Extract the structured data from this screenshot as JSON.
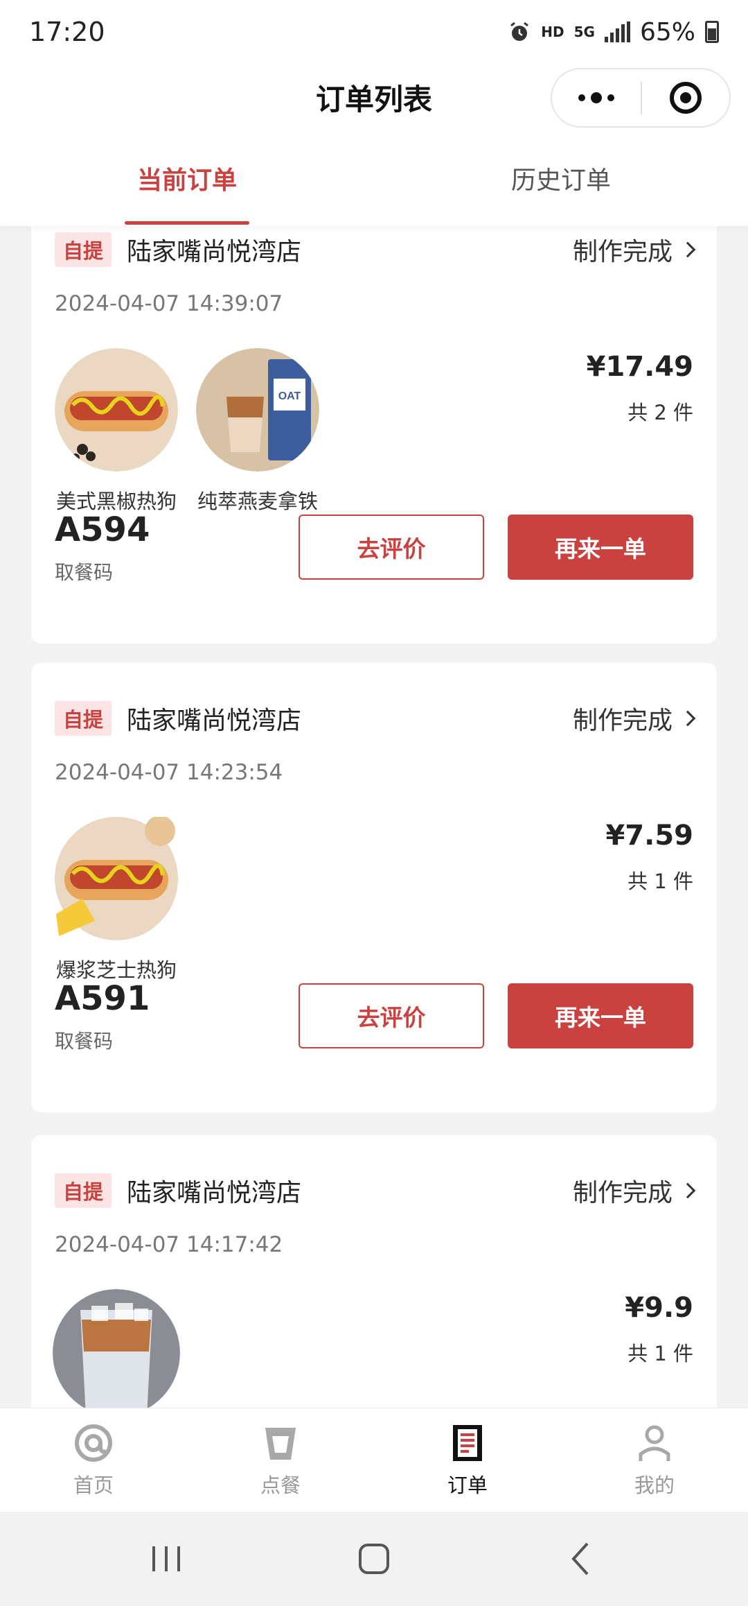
{
  "status_bar": {
    "time": "17:20",
    "hd": "HD",
    "network": "5G",
    "battery": "65%"
  },
  "nav": {
    "title": "订单列表"
  },
  "tabs": [
    {
      "label": "当前订单",
      "active": true
    },
    {
      "label": "历史订单",
      "active": false
    }
  ],
  "orders": [
    {
      "pickup_type": "自提",
      "store": "陆家嘴尚悦湾店",
      "status": "制作完成",
      "time": "2024-04-07 14:39:07",
      "items": [
        {
          "name": "美式黑椒热狗",
          "icon": "hotdog-image"
        },
        {
          "name": "纯萃燕麦拿铁",
          "icon": "oat-latte-image"
        }
      ],
      "price": "¥17.49",
      "count": "共 2 件",
      "code": "A594",
      "code_label": "取餐码",
      "review_label": "去评价",
      "reorder_label": "再来一单"
    },
    {
      "pickup_type": "自提",
      "store": "陆家嘴尚悦湾店",
      "status": "制作完成",
      "time": "2024-04-07 14:23:54",
      "items": [
        {
          "name": "爆浆芝士热狗",
          "icon": "cheese-hotdog-image"
        }
      ],
      "price": "¥7.59",
      "count": "共 1 件",
      "code": "A591",
      "code_label": "取餐码",
      "review_label": "去评价",
      "reorder_label": "再来一单"
    },
    {
      "pickup_type": "自提",
      "store": "陆家嘴尚悦湾店",
      "status": "制作完成",
      "time": "2024-04-07 14:17:42",
      "items": [
        {
          "name": "",
          "icon": "iced-latte-image"
        }
      ],
      "price": "¥9.9",
      "count": "共 1 件"
    }
  ],
  "tabbar": [
    {
      "label": "首页",
      "icon": "home-at-icon"
    },
    {
      "label": "点餐",
      "icon": "cup-icon"
    },
    {
      "label": "订单",
      "icon": "order-list-icon",
      "active": true
    },
    {
      "label": "我的",
      "icon": "profile-icon"
    }
  ],
  "colors": {
    "accent": "#c9423f",
    "badge_bg": "#fbe4e3",
    "page_bg": "#f3f3f3"
  }
}
